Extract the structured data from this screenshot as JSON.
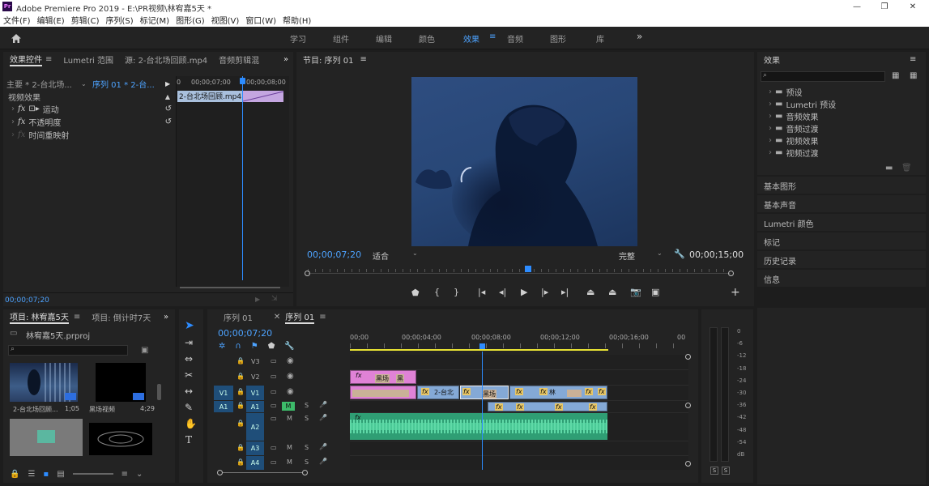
{
  "window": {
    "title": "Adobe Premiere Pro 2019 - E:\\PR视频\\林宥嘉5天 *",
    "min": "—",
    "max": "❐",
    "close": "✕"
  },
  "menu": [
    "文件(F)",
    "编辑(E)",
    "剪辑(C)",
    "序列(S)",
    "标记(M)",
    "图形(G)",
    "视图(V)",
    "窗口(W)",
    "帮助(H)"
  ],
  "workspaces": [
    {
      "label": "学习",
      "active": false
    },
    {
      "label": "组件",
      "active": false
    },
    {
      "label": "编辑",
      "active": false
    },
    {
      "label": "颜色",
      "active": false
    },
    {
      "label": "效果",
      "active": true
    },
    {
      "label": "音频",
      "active": false
    },
    {
      "label": "图形",
      "active": false
    },
    {
      "label": "库",
      "active": false
    }
  ],
  "workspace_more": "»",
  "effect_controls": {
    "tabs": [
      "效果控件",
      "Lumetri 范围",
      "源: 2-台北场回顾.mp4",
      "音频剪辑混"
    ],
    "master": "主要 * 2-台北场...",
    "seq": "序列 01 * 2-台...",
    "ruler": {
      "t1": "0",
      "t2": "00;00;07;00",
      "t3": "00;00;08;00"
    },
    "clip_name": "2-台北场回顾.mp4",
    "section": "视频效果",
    "rows": [
      "运动",
      "不透明度",
      "时间重映射"
    ],
    "timecode": "00;00;07;20"
  },
  "program": {
    "title": "节目: 序列 01",
    "timecode": "00;00;07;20",
    "fit": "适合",
    "quality": "完整",
    "duration": "00;00;15;00"
  },
  "effects_panel": {
    "title": "效果",
    "folders": [
      "预设",
      "Lumetri 预设",
      "音频效果",
      "音频过渡",
      "视频效果",
      "视频过渡"
    ],
    "sections": [
      "基本图形",
      "基本声音",
      "Lumetri 颜色",
      "标记",
      "历史记录",
      "信息"
    ]
  },
  "project": {
    "tabs": [
      "项目: 林宥嘉5天",
      "项目: 倒计时7天"
    ],
    "file": "林宥嘉5天.prproj",
    "items": [
      {
        "name": "2-台北场回顾...",
        "dur": "1;05"
      },
      {
        "name": "黑场视频",
        "dur": "4;29"
      }
    ]
  },
  "timeline": {
    "tabs": [
      "序列 01",
      "序列 01"
    ],
    "timecode": "00;00;07;20",
    "ruler": [
      "00;00",
      "00;00;04;00",
      "00;00;08;00",
      "00;00;12;00",
      "00;00;16;00",
      "00"
    ],
    "video_tracks": [
      "V3",
      "V2",
      "V1"
    ],
    "audio_tracks": [
      "A1",
      "A2",
      "A3",
      "A4"
    ],
    "src_v": "V1",
    "src_a": "A1",
    "clips": {
      "v2a": "黑场",
      "v2b": "黑",
      "v1a": "2-台北",
      "v1b": "黑场",
      "v1c": "林",
      "fx": "fx"
    }
  },
  "meter": {
    "scale": [
      "0",
      "-6",
      "-12",
      "-18",
      "-24",
      "-30",
      "-36",
      "-42",
      "-48",
      "-54",
      "dB"
    ],
    "solo": "S"
  },
  "colors": {
    "accent": "#4da3ff",
    "clip_pink": "#e082d6",
    "clip_blue": "#84a9d6",
    "audio_green": "#3dbb8a",
    "playhead": "#2d8cff",
    "work_area": "#e8e233"
  }
}
